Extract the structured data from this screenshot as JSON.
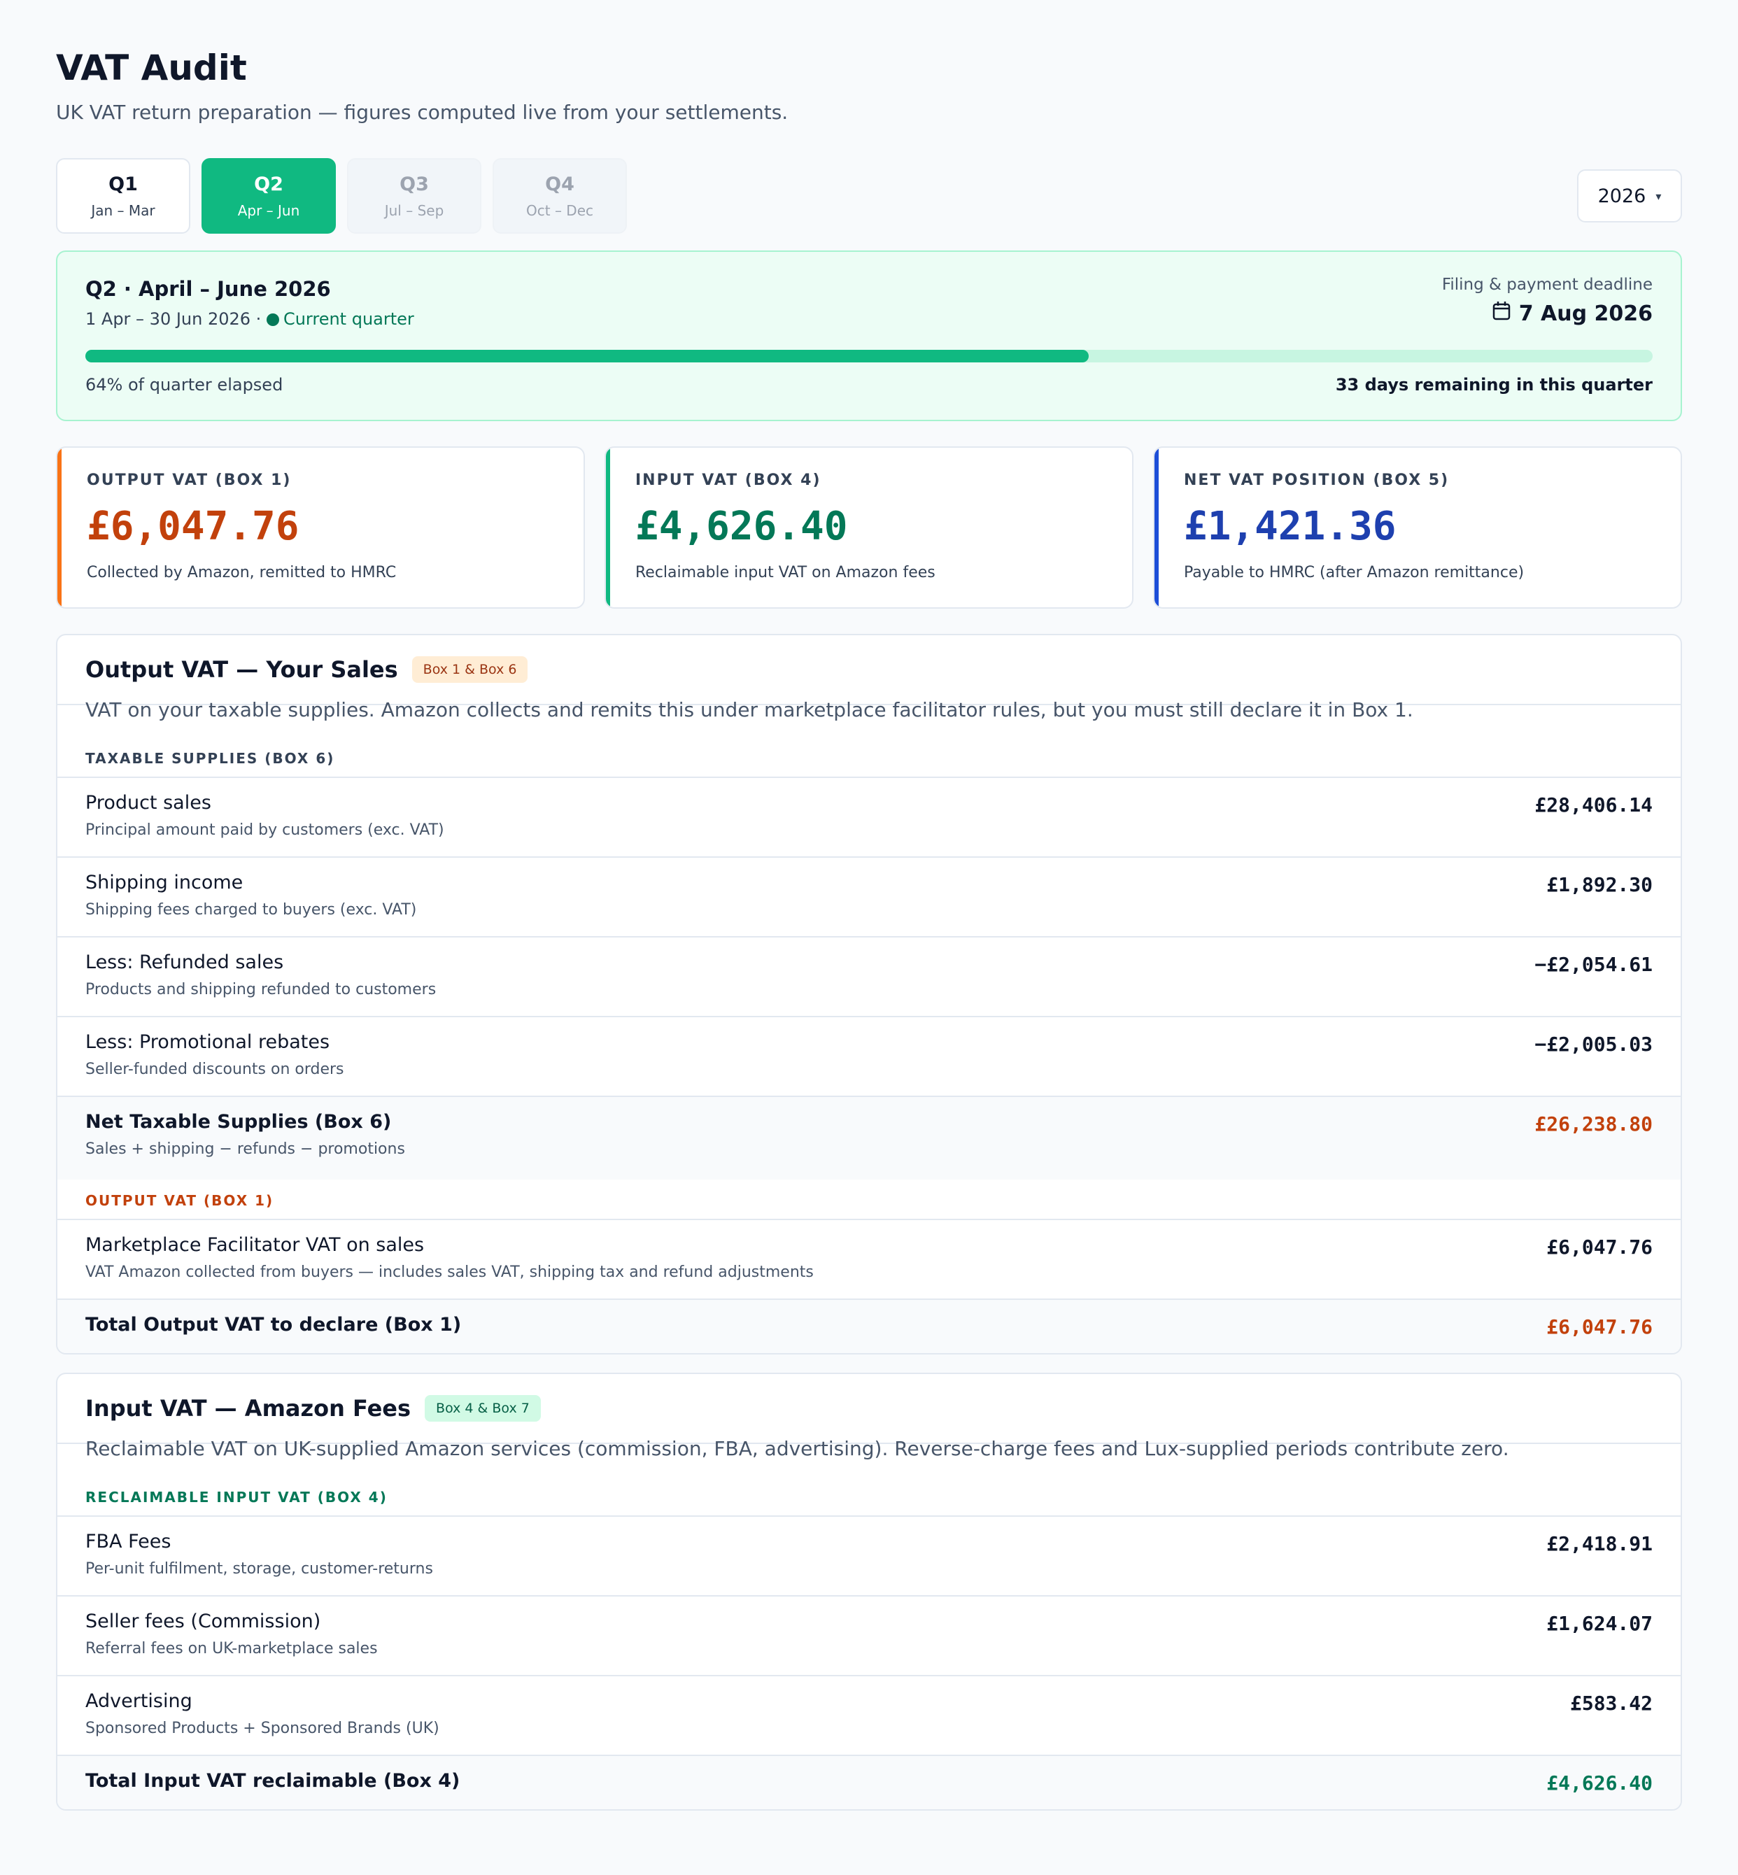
{
  "header": {
    "title": "VAT Audit",
    "subtitle": "UK VAT return preparation — figures computed live from your settlements."
  },
  "quarters": [
    {
      "name": "Q1",
      "range": "Jan – Mar"
    },
    {
      "name": "Q2",
      "range": "Apr – Jun"
    },
    {
      "name": "Q3",
      "range": "Jul – Sep"
    },
    {
      "name": "Q4",
      "range": "Oct – Dec"
    }
  ],
  "year_select": {
    "value": "2026",
    "caret": "▾"
  },
  "banner": {
    "title": "Q2 · April – June 2026",
    "dates": "1 Apr – 30 Jun 2026 ·",
    "status": "Current quarter",
    "deadline_label": "Filing & payment deadline",
    "deadline": "7 Aug 2026",
    "progress_fraction": 0.64,
    "elapsed_text": "64% of quarter elapsed",
    "remaining_text": "33 days remaining in this quarter"
  },
  "kpis": [
    {
      "label": "OUTPUT VAT (BOX 1)",
      "value": "£6,047.76",
      "desc": "Collected by Amazon, remitted to HMRC",
      "color": "#c2410c",
      "accent": "#f97316"
    },
    {
      "label": "INPUT VAT (BOX 4)",
      "value": "£4,626.40",
      "desc": "Reclaimable input VAT on Amazon fees",
      "color": "#047857",
      "accent": "#10b981"
    },
    {
      "label": "NET VAT POSITION (BOX 5)",
      "value": "£1,421.36",
      "desc": "Payable to HMRC (after Amazon remittance)",
      "color": "#1e40af",
      "accent": "#1d4ed8"
    }
  ],
  "output_card": {
    "title": "Output VAT — Your Sales",
    "tag": "Box 1 & Box 6",
    "desc": "VAT on your taxable supplies. Amazon collects and remits this under marketplace facilitator rules, but you must still declare it in Box 1.",
    "section1": "TAXABLE SUPPLIES (BOX 6)",
    "rows": [
      {
        "title": "Product sales",
        "sub": "Principal amount paid by customers (exc. VAT)",
        "value": "£28,406.14"
      },
      {
        "title": "Shipping income",
        "sub": "Shipping fees charged to buyers (exc. VAT)",
        "value": "£1,892.30"
      },
      {
        "title": "Less: Refunded sales",
        "sub": "Products and shipping refunded to customers",
        "value": "−£2,054.61"
      },
      {
        "title": "Less: Promotional rebates",
        "sub": "Seller-funded discounts on orders",
        "value": "−£2,005.03"
      }
    ],
    "net_row": {
      "title": "Net Taxable Supplies (Box 6)",
      "sub": "Sales + shipping − refunds − promotions",
      "value": "£26,238.80"
    },
    "section2": "OUTPUT VAT (BOX 1)",
    "mf_row": {
      "title": "Marketplace Facilitator VAT on sales",
      "sub": "VAT Amazon collected from buyers — includes sales VAT, shipping tax and refund adjustments",
      "value": "£6,047.76"
    },
    "total_row": {
      "title": "Total Output VAT to declare (Box 1)",
      "value": "£6,047.76"
    }
  },
  "input_card": {
    "title": "Input VAT — Amazon Fees",
    "tag": "Box 4 & Box 7",
    "desc": "Reclaimable VAT on UK-supplied Amazon services (commission, FBA, advertising). Reverse-charge fees and Lux-supplied periods contribute zero.",
    "section1": "RECLAIMABLE INPUT VAT (BOX 4)",
    "rows": [
      {
        "title": "FBA Fees",
        "sub": "Per-unit fulfilment, storage, customer-returns",
        "value": "£2,418.91"
      },
      {
        "title": "Seller fees (Commission)",
        "sub": "Referral fees on UK-marketplace sales",
        "value": "£1,624.07"
      },
      {
        "title": "Advertising",
        "sub": "Sponsored Products + Sponsored Brands (UK)",
        "value": "£583.42"
      }
    ],
    "total_row": {
      "title": "Total Input VAT reclaimable (Box 4)",
      "value": "£4,626.40"
    }
  },
  "colors": {
    "brand_green": "#10b981",
    "output_orange": "#c2410c",
    "input_green": "#047857",
    "net_blue": "#1e40af"
  }
}
